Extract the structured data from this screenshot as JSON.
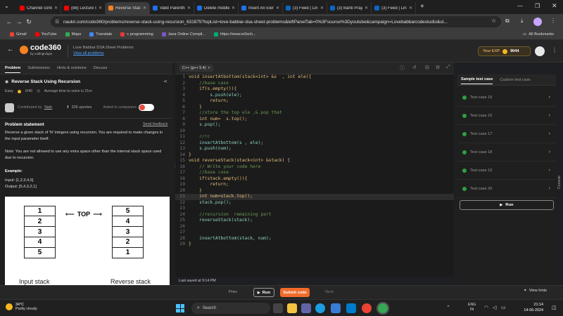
{
  "browser": {
    "tabs": [
      {
        "label": "Channel conte",
        "color": "#ff0000",
        "active": false
      },
      {
        "label": "(88) Lecture 5",
        "color": "#ff0000",
        "active": false
      },
      {
        "label": "Reverse Stack",
        "color": "#f58220",
        "active": true
      },
      {
        "label": "Valid Parenthe",
        "color": "#1a73e8",
        "active": false
      },
      {
        "label": "Delete middle",
        "color": "#1a73e8",
        "active": false
      },
      {
        "label": "Insert An Elen",
        "color": "#1a73e8",
        "active": false
      },
      {
        "label": "(3) Feed | Link",
        "color": "#0a66c2",
        "active": false
      },
      {
        "label": "(3) Banti Praja",
        "color": "#0a66c2",
        "active": false
      },
      {
        "label": "(3) Feed | Link",
        "color": "#0a66c2",
        "active": false
      }
    ],
    "new_tab": "+",
    "url": "naukri.com/code360/problems/reverse-stack-using-recursion_631875?topList=love-babbar-dsa-sheet-problems&leftPanelTab=0%3Fsource%3Dyoutube&campaign=Lovebabbarcodestudio&ut...",
    "bookmarks": [
      {
        "label": "Gmail",
        "color": "#ea4335"
      },
      {
        "label": "YouTube",
        "color": "#ff0000"
      },
      {
        "label": "Maps",
        "color": "#34a853"
      },
      {
        "label": "Translate",
        "color": "#4285f4"
      },
      {
        "label": "c programming",
        "color": "#e53935"
      },
      {
        "label": "Java Online Compil...",
        "color": "#7e57c2"
      },
      {
        "label": "https://www.w3sch...",
        "color": "#04aa6d"
      }
    ],
    "all_bookmarks": "All Bookmarks"
  },
  "site": {
    "logo_main": "code360",
    "logo_sub": "by codingninjas",
    "sheet_title": "Love Babbar DSA Sheet Problems",
    "view_all": "View all problems",
    "exp_label": "Your EXP",
    "exp_value": "9044",
    "accent": "#f58220"
  },
  "problem_tabs": [
    "Problem",
    "Submissions",
    "Hints & solutions",
    "Discuss"
  ],
  "problem": {
    "title": "Reverse Stack Using Recursion",
    "difficulty": "Easy",
    "score": "0/40",
    "avg_time": "Average time to solve is 21m",
    "contributed_label": "Contributed by",
    "contributor": "Yash",
    "upvotes": "328 upvotes",
    "asked_label": "Asked in companies",
    "statement_heading": "Problem statement",
    "send_feedback": "Send feedback",
    "statement": "Reverse a given stack of 'N' integers using recursion. You are required to make changes in the input parameter itself.",
    "note": "Note: You are not allowed to use any extra space other than the internal stack space used due to recursion.",
    "example_heading": "Example:",
    "input": "Input: [1,2,3,4,5]",
    "output": "Output: [5,4,3,2,1]",
    "diagram": {
      "left": [
        "1",
        "2",
        "3",
        "4",
        "5"
      ],
      "right": [
        "5",
        "4",
        "3",
        "2",
        "1"
      ],
      "top_label": "TOP",
      "left_caption": "Input stack",
      "right_caption": "Reverse stack"
    }
  },
  "editor": {
    "language": "C++ (g++ 5.4)",
    "saved": "Last saved at 9:14 PM",
    "lines": [
      "void insertAtbottom(stack<int> &s  , int ele){",
      "    //base case",
      "    if(s.empty()){",
      "        s.push(ele);",
      "        return;",
      "    }",
      "    //store the top ele ,& pop that",
      "    int num=  s.top();",
      "    s.pop();",
      "",
      "    //rc",
      "    insertAtbottom(s , ele);",
      "    s.push(num);",
      "}",
      "void reverseStack(stack<int> &stack) {",
      "    // Write your code here",
      "    //base case",
      "    if(stack.empty()){",
      "        return;",
      "    }",
      "    int num=stack.top();",
      "    stack.pop();",
      "",
      "    //recursion  remaining part",
      "    reverseStack(stack);",
      "",
      "",
      "    insertAtbottom(stack, num);",
      "}"
    ],
    "highlight_line": 21
  },
  "tests": {
    "tabs": [
      "Sample test case",
      "Custom test case"
    ],
    "cases": [
      "Test case 15",
      "Test case 16",
      "Test case 17",
      "Test case 18",
      "Test case 19",
      "Test case 20"
    ],
    "run": "Run",
    "console": "Console"
  },
  "bottom": {
    "prev": "Prev",
    "run": "Run",
    "submit": "Submit code",
    "next": "Next",
    "view_hints": "View hints"
  },
  "taskbar": {
    "temp": "34°C",
    "weather": "Partly cloudy",
    "search": "Search",
    "lang1": "ENG",
    "lang2": "IN",
    "time": "21:14",
    "date": "14-06-2024"
  }
}
